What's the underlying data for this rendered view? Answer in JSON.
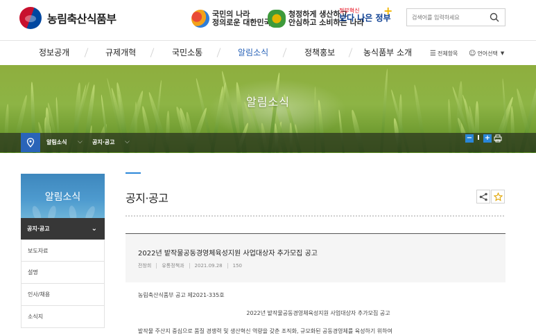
{
  "header": {
    "logo_text": "농림축산식품부",
    "slogan1": {
      "line1": "국민의 나라",
      "line2": "정의로운 대한민국"
    },
    "slogan2": {
      "line1": "청정하게 생산하고",
      "line2": "안심하고 소비하는 나라"
    },
    "slogan3": {
      "small": "정부혁신",
      "big": "보다 나은 정부"
    },
    "search_placeholder": "검색어를 입력하세요"
  },
  "gnb": {
    "items": [
      "정보공개",
      "규제개혁",
      "국민소통",
      "알림소식",
      "정책홍보",
      "농식품부 소개"
    ],
    "active_index": 3,
    "util_all_menu": "전체항목",
    "util_language": "언어선택"
  },
  "banner": {
    "title": "알림소식"
  },
  "location": {
    "level1": "알림소식",
    "level2": "공지·공고"
  },
  "font_controls": {
    "minus": "−",
    "reset": "I",
    "plus": "+"
  },
  "lnb": {
    "title": "알림소식",
    "active": "공지·공고",
    "items": [
      "보도자료",
      "설명",
      "인사/채용",
      "소식지"
    ]
  },
  "content": {
    "page_title": "공지·공고",
    "post": {
      "title": "2022년 밭작물공동경영체육성지원 사업대상자 추가모집 공고",
      "author": "전창희",
      "dept": "유통정책과",
      "date": "2021.09.28",
      "views": "150"
    },
    "body": {
      "line1": "농림축산식품부 공고 제2021-335호",
      "line2": "2022년 밭작물공동경영체육성지원 사업대상자 추가모집 공고",
      "line3": "밭작물 주산지 중심으로 품질 경쟁력 및 생산혁신 역량을 갖춘 조직화, 규모화된 공동경영체를 육성하기 위하여"
    }
  },
  "colors": {
    "primary": "#2a64b8",
    "accent": "#2a86d8",
    "lnb_active_bg": "#373737"
  }
}
